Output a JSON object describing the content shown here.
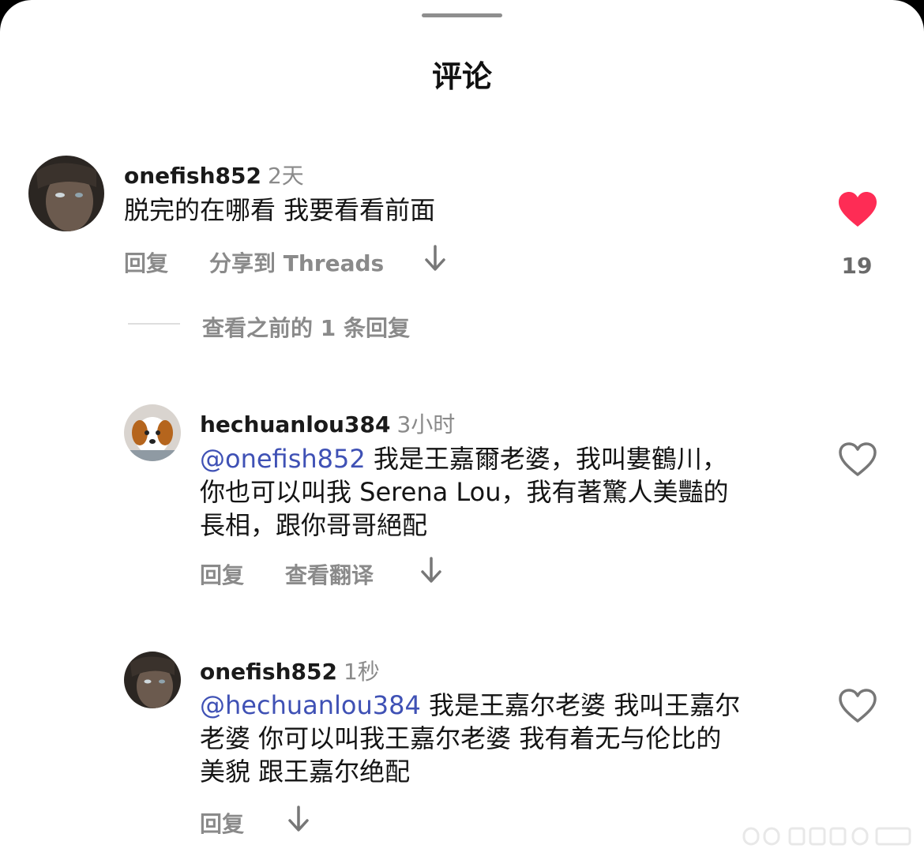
{
  "header": {
    "title": "评论"
  },
  "comments": [
    {
      "username": "onefish852",
      "time": "2天",
      "text": "脱完的在哪看 我要看看前面",
      "actions": {
        "reply": "回复",
        "share": "分享到 Threads"
      },
      "liked": true,
      "like_count": "19"
    },
    {
      "username": "hechuanlou384",
      "time": "3小时",
      "mention": "@onefish852",
      "text_line1": " 我是王嘉爾老婆，我叫婁鶴川，",
      "text_line2": "你也可以叫我 Serena Lou，我有著驚人美豔的",
      "text_line3": "長相，跟你哥哥絕配",
      "actions": {
        "reply": "回复",
        "translate": "查看翻译"
      },
      "liked": false
    },
    {
      "username": "onefish852",
      "time": "1秒",
      "mention": "@hechuanlou384",
      "text_line1": " 我是王嘉尔老婆 我叫王嘉尔",
      "text_line2": "老婆 你可以叫我王嘉尔老婆 我有着无与伦比的",
      "text_line3": "美貌 跟王嘉尔绝配",
      "actions": {
        "reply": "回复"
      },
      "liked": false
    }
  ],
  "view_previous": "查看之前的 1 条回复",
  "colors": {
    "mention": "#3f51b5",
    "heart_liked": "#fe2c55",
    "muted": "#8a8a8a"
  }
}
